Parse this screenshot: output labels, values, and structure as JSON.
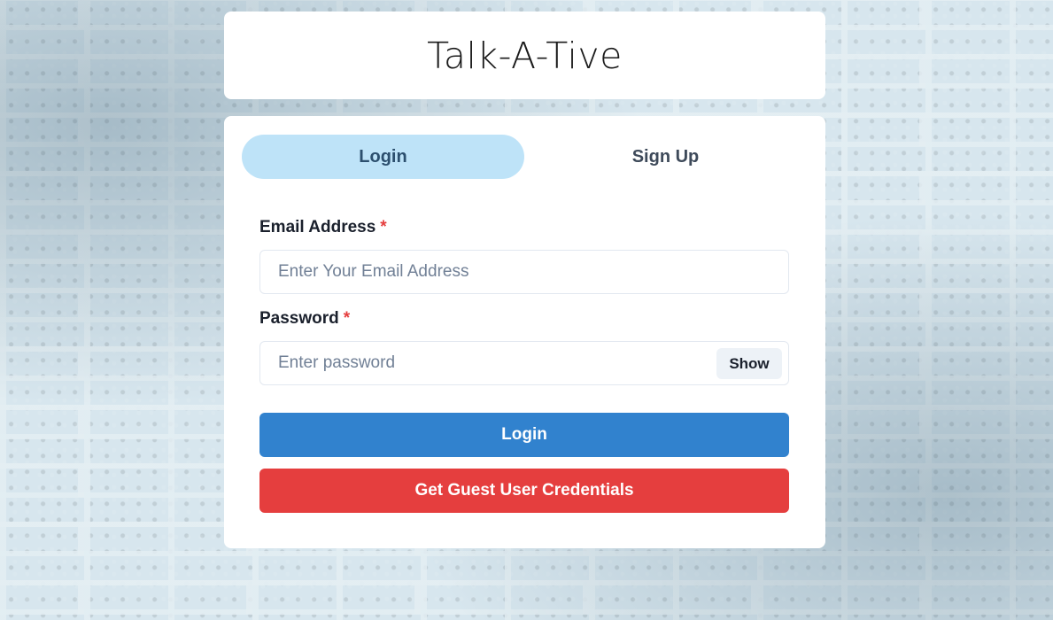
{
  "app": {
    "title": "Talk-A-Tive"
  },
  "tabs": [
    {
      "label": "Login",
      "active": true
    },
    {
      "label": "Sign Up",
      "active": false
    }
  ],
  "form": {
    "email": {
      "label": "Email Address",
      "required_mark": "*",
      "value": "",
      "placeholder": "Enter Your Email Address"
    },
    "password": {
      "label": "Password",
      "required_mark": "*",
      "value": "",
      "placeholder": "Enter password",
      "toggle_label": "Show"
    },
    "submit_label": "Login",
    "guest_label": "Get Guest User Credentials"
  },
  "colors": {
    "tab_active_bg": "#bee3f8",
    "primary": "#3182ce",
    "danger": "#e53e3e",
    "background": "#3a7a98"
  }
}
